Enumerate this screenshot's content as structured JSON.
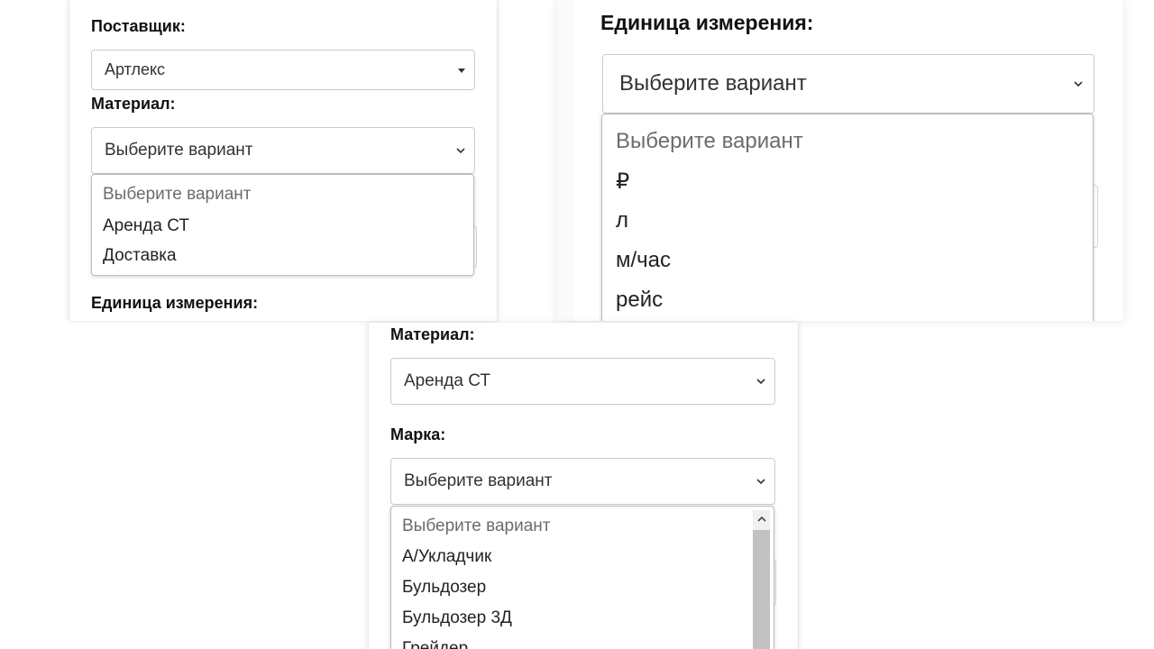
{
  "left_panel": {
    "supplier_label": "Поставщик:",
    "supplier_value": "Артлекс",
    "material_label": "Материал:",
    "material_value": "Выберите вариант",
    "material_options": [
      "Выберите вариант",
      "Аренда СТ",
      "Доставка"
    ],
    "unit_label": "Единица измерения:"
  },
  "right_panel": {
    "unit_label": "Единица измерения:",
    "unit_value": "Выберите вариант",
    "unit_options": [
      "Выберите вариант",
      "₽",
      "л",
      "м/час",
      "рейс"
    ]
  },
  "bottom_panel": {
    "material_label": "Материал:",
    "material_value": "Аренда СТ",
    "brand_label": "Марка:",
    "brand_value": "Выберите вариант",
    "brand_options": [
      "Выберите вариант",
      "А/Укладчик",
      "Бульдозер",
      "Бульдозер 3Д",
      "Грейдер"
    ]
  },
  "icons": {
    "select_arrow": "chevron-down-icon",
    "supplier_arrow": "caret-down-icon",
    "scroll_up": "chevron-up-icon"
  },
  "colors": {
    "label_text": "#111111",
    "placeholder_option": "#6c6c6c",
    "border": "#c8ccd0",
    "scroll_thumb": "#c1c1c1"
  }
}
